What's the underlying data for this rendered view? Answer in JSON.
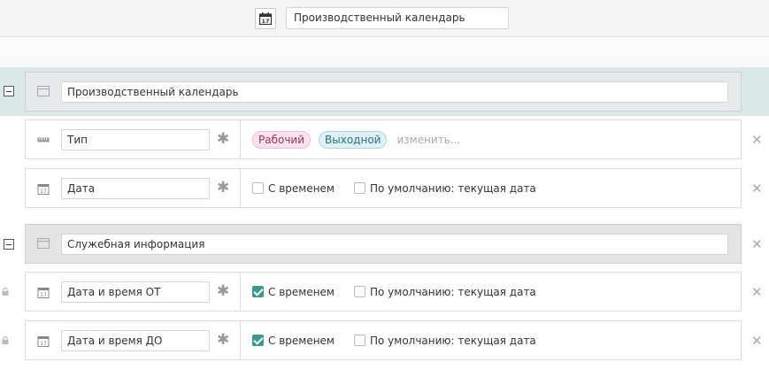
{
  "header": {
    "icon": "calendar-icon",
    "title_value": "Производственный календарь"
  },
  "sections": [
    {
      "title": "Производственный календарь",
      "fields": [
        {
          "icon": "ruler-icon",
          "name": "Тип",
          "required_glyph": "✱",
          "tags": [
            "Рабочий",
            "Выходной"
          ],
          "edit_label": "изменить..."
        },
        {
          "icon": "calendar-icon",
          "name": "Дата",
          "required_glyph": "✱",
          "with_time_label": "С временем",
          "with_time_checked": false,
          "default_label": "По умолчанию: текущая дата",
          "default_checked": false
        }
      ]
    },
    {
      "title": "Служебная информация",
      "fields": [
        {
          "icon": "calendar-icon",
          "locked": true,
          "name": "Дата и время ОТ",
          "required_glyph": "✱",
          "with_time_label": "С временем",
          "with_time_checked": true,
          "default_label": "По умолчанию: текущая дата",
          "default_checked": false
        },
        {
          "icon": "calendar-icon",
          "locked": true,
          "name": "Дата и время ДО",
          "required_glyph": "✱",
          "with_time_label": "С временем",
          "with_time_checked": true,
          "default_label": "По умолчанию: текущая дата",
          "default_checked": false
        }
      ]
    }
  ],
  "delete_glyph": "✕",
  "colors": {
    "accent_checkbox": "#3a9a8c",
    "section_highlight": "#dbe8e8",
    "tag_pink": "#fbe3ee",
    "tag_blue": "#e0f2f7"
  }
}
